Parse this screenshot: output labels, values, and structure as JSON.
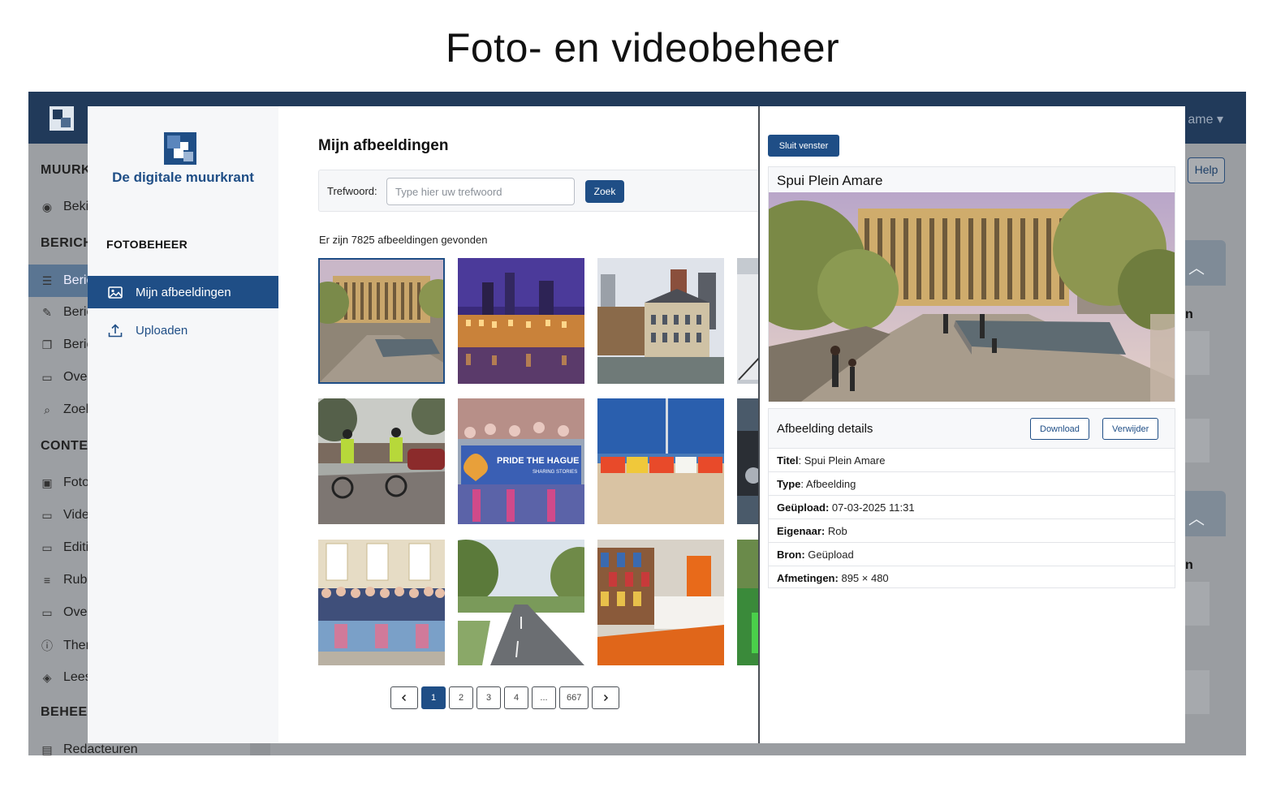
{
  "heading": "Foto- en videobeheer",
  "background_app": {
    "username": "ame",
    "help_label": "Help",
    "sidebar": [
      {
        "type": "section",
        "label": "MUURK"
      },
      {
        "type": "item",
        "label": "Beki",
        "icon": "eye-icon"
      },
      {
        "type": "section",
        "label": "BERICHT"
      },
      {
        "type": "item",
        "label": "Beric",
        "icon": "list-icon",
        "active": true
      },
      {
        "type": "item",
        "label": "Beric",
        "icon": "pencil-icon"
      },
      {
        "type": "item",
        "label": "Beric",
        "icon": "copy-icon"
      },
      {
        "type": "item",
        "label": "Ove",
        "icon": "archive-icon"
      },
      {
        "type": "item",
        "label": "Zoel",
        "icon": "search-icon"
      },
      {
        "type": "section",
        "label": "CONTEN"
      },
      {
        "type": "item",
        "label": "Foto",
        "icon": "image-icon"
      },
      {
        "type": "item",
        "label": "Vide",
        "icon": "video-icon"
      },
      {
        "type": "item",
        "label": "Editi",
        "icon": "monitor-icon"
      },
      {
        "type": "item",
        "label": "Rubr",
        "icon": "menu-icon"
      },
      {
        "type": "item",
        "label": "Ove",
        "icon": "archive-icon"
      },
      {
        "type": "item",
        "label": "Ther",
        "icon": "info-icon"
      },
      {
        "type": "item",
        "label": "Lees",
        "icon": "layers-icon"
      },
      {
        "type": "section",
        "label": "BEHEER"
      },
      {
        "type": "item",
        "label": "Redacteuren",
        "icon": "id-card-icon"
      }
    ],
    "right_labels": [
      "n",
      "n"
    ]
  },
  "modal": {
    "brand_name": "De digitale muurkrant",
    "sidebar_section": "FOTOBEHEER",
    "sidebar_items": [
      {
        "label": "Mijn afbeeldingen",
        "icon": "image-icon",
        "active": true
      },
      {
        "label": "Uploaden",
        "icon": "upload-icon",
        "active": false
      }
    ],
    "main": {
      "title": "Mijn afbeeldingen",
      "search_label": "Trefwoord:",
      "search_placeholder": "Type hier uw trefwoord",
      "search_button": "Zoek",
      "result_count": "Er zijn 7825 afbeeldingen gevonden",
      "pride_banner_line1": "PRIDE THE HAGUE",
      "pride_banner_line2": "SHARING STORIES",
      "pagination": {
        "pages": [
          "1",
          "2",
          "3",
          "4",
          "...",
          "667"
        ],
        "current": "1",
        "prev_icon": "chevron-left-icon",
        "next_icon": "chevron-right-icon"
      }
    },
    "detail": {
      "close_label": "Sluit venster",
      "image_title": "Spui Plein Amare",
      "details_title": "Afbeelding details",
      "download_label": "Download",
      "delete_label": "Verwijder",
      "rows": [
        {
          "label": "Titel",
          "sep": ": ",
          "value": "Spui Plein Amare"
        },
        {
          "label": "Type",
          "sep": ": ",
          "value": "Afbeelding"
        },
        {
          "label": "Geüpload:",
          "sep": " ",
          "value": "07-03-2025 11:31"
        },
        {
          "label": "Eigenaar:",
          "sep": " ",
          "value": "Rob"
        },
        {
          "label": "Bron:",
          "sep": " ",
          "value": "Geüpload"
        },
        {
          "label": "Afmetingen:",
          "sep": " ",
          "value": "895 × 480"
        }
      ]
    }
  },
  "colors": {
    "brand": "#1f4e86",
    "topbar": "#213a5a",
    "overlay": "#8f9296"
  }
}
